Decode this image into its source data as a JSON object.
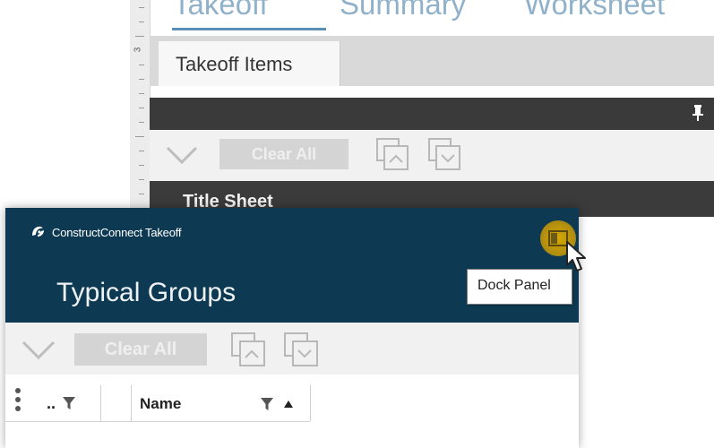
{
  "main_tabs": [
    {
      "label": "Takeoff",
      "active": true
    },
    {
      "label": "Summary",
      "active": false
    },
    {
      "label": "Worksheet",
      "active": false
    }
  ],
  "ruler": {
    "number": "3"
  },
  "sub_tab": {
    "label": "Takeoff Items"
  },
  "bg_toolbar": {
    "clear_all_label": "Clear All"
  },
  "bg_list": {
    "title_sheet_label": "Title Sheet"
  },
  "panel": {
    "brand": "ConstructConnect Takeoff",
    "title": "Typical Groups",
    "dock_tooltip": "Dock Panel",
    "toolbar": {
      "clear_all_label": "Clear All"
    },
    "grid_columns": [
      {
        "label": ".."
      },
      {
        "label": ""
      },
      {
        "label": "Name"
      }
    ]
  },
  "icons": {
    "pin": "pin-icon",
    "chevron": "chevron-down-icon",
    "collapse_all": "collapse-all-icon",
    "expand_all": "expand-all-icon",
    "filter": "filter-icon",
    "sort": "sort-ascending-icon",
    "grip": "column-chooser-icon",
    "dock": "dock-panel-icon",
    "cursor": "mouse-cursor-icon"
  },
  "colors": {
    "panel_header": "#0d3a52",
    "dark_bar": "#3a3a3a",
    "tab_accent": "#5b8fb8",
    "dock_highlight": "#c9a31a"
  }
}
